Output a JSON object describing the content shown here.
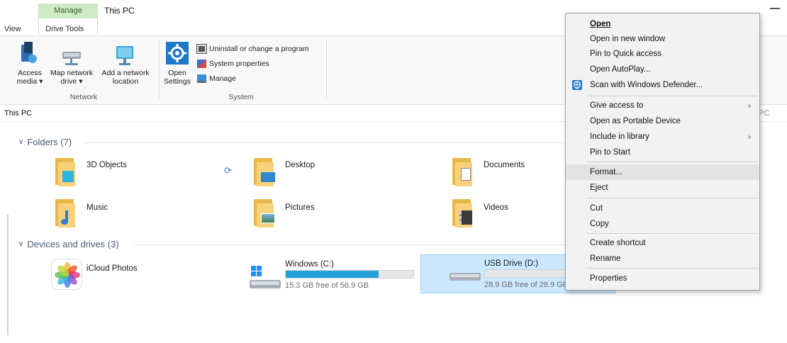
{
  "window": {
    "context_tab_group": "Manage",
    "title": "This PC",
    "tabs": [
      "View",
      "Drive Tools"
    ]
  },
  "ribbon": {
    "network": {
      "access_media": "Access\nmedia ▾",
      "map_network_drive": "Map network\ndrive ▾",
      "add_network_location": "Add a network\nlocation",
      "group_label": "Network"
    },
    "system": {
      "open_settings": "Open\nSettings",
      "uninstall": "Uninstall or change a program",
      "system_properties": "System properties",
      "manage": "Manage",
      "group_label": "System"
    }
  },
  "address": {
    "path": "This PC",
    "right_partial": "PC"
  },
  "folders": {
    "heading": "Folders (7)",
    "items": [
      "3D Objects",
      "Desktop",
      "Documents",
      "Music",
      "Pictures",
      "Videos"
    ]
  },
  "devices": {
    "heading": "Devices and drives (3)",
    "icloud": "iCloud Photos",
    "drives": [
      {
        "name": "Windows (C:)",
        "free": "15.3 GB free of 56.9 GB",
        "used_fraction": 0.73
      },
      {
        "name": "USB Drive (D:)",
        "free": "28.9 GB free of 28.9 GB",
        "used_fraction": 0.0
      }
    ]
  },
  "context_menu": {
    "open": "Open",
    "open_new_window": "Open in new window",
    "pin_quick_access": "Pin to Quick access",
    "open_autoplay": "Open AutoPlay...",
    "scan_defender": "Scan with Windows Defender...",
    "give_access": "Give access to",
    "open_portable": "Open as Portable Device",
    "include_library": "Include in library",
    "pin_start": "Pin to Start",
    "format": "Format...",
    "eject": "Eject",
    "cut": "Cut",
    "copy": "Copy",
    "create_shortcut": "Create shortcut",
    "rename": "Rename",
    "properties": "Properties"
  },
  "colors": {
    "accent": "#26a0da",
    "context_tab": "#cfe9c4",
    "selection": "#cce8ff",
    "folder": "#f7d27a"
  }
}
